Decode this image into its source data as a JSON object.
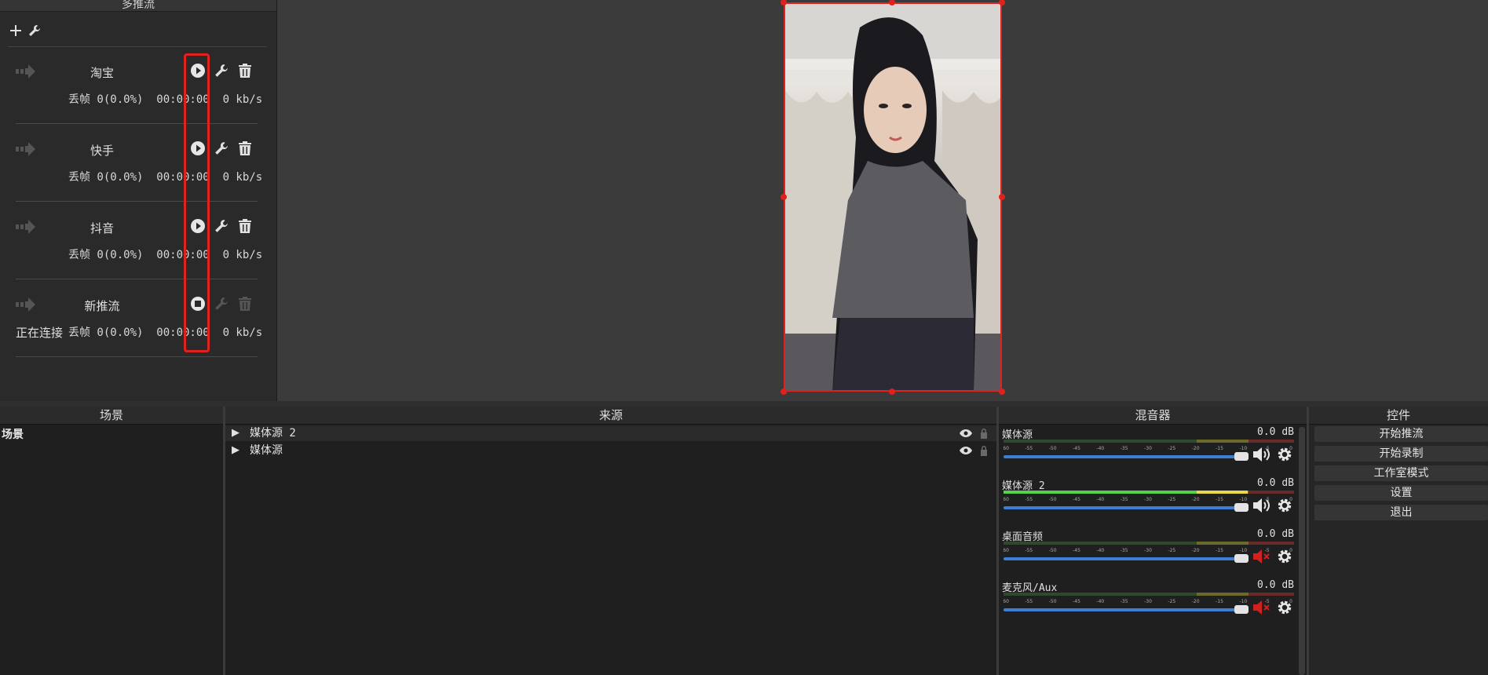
{
  "multi_stream": {
    "title": "多推流",
    "rows": [
      {
        "name": "淘宝",
        "state": "play",
        "stats": "丢帧 0(0.0%)  00:00:00  0 kb/s"
      },
      {
        "name": "快手",
        "state": "play",
        "stats": "丢帧 0(0.0%)  00:00:00  0 kb/s"
      },
      {
        "name": "抖音",
        "state": "play",
        "stats": "丢帧 0(0.0%)  00:00:00  0 kb/s"
      },
      {
        "name": "新推流",
        "state": "stop",
        "connecting": "正在连接",
        "stats": "丢帧 0(0.0%)  00:00:00  0 kb/s"
      }
    ]
  },
  "scenes": {
    "title": "场景",
    "items": [
      "场景"
    ]
  },
  "sources": {
    "title": "来源",
    "items": [
      "媒体源 2",
      "媒体源"
    ]
  },
  "mixer": {
    "title": "混音器",
    "channels": [
      {
        "name": "媒体源",
        "db": "0.0 dB",
        "muted": false,
        "level": 0
      },
      {
        "name": "媒体源 2",
        "db": "0.0 dB",
        "muted": false,
        "level": 0.84
      },
      {
        "name": "桌面音频",
        "db": "0.0 dB",
        "muted": true,
        "level": 0
      },
      {
        "name": "麦克风/Aux",
        "db": "0.0 dB",
        "muted": true,
        "level": 0
      }
    ],
    "scale": [
      "-60",
      "-55",
      "-50",
      "-45",
      "-40",
      "-35",
      "-30",
      "-25",
      "-20",
      "-15",
      "-10",
      "-5",
      "0"
    ]
  },
  "controls": {
    "title": "控件",
    "buttons": [
      "开始推流",
      "开始录制",
      "工作室模式",
      "设置",
      "退出"
    ]
  },
  "colors": {
    "accent_red": "#e0221f",
    "fader_blue": "#3a7fd1"
  }
}
